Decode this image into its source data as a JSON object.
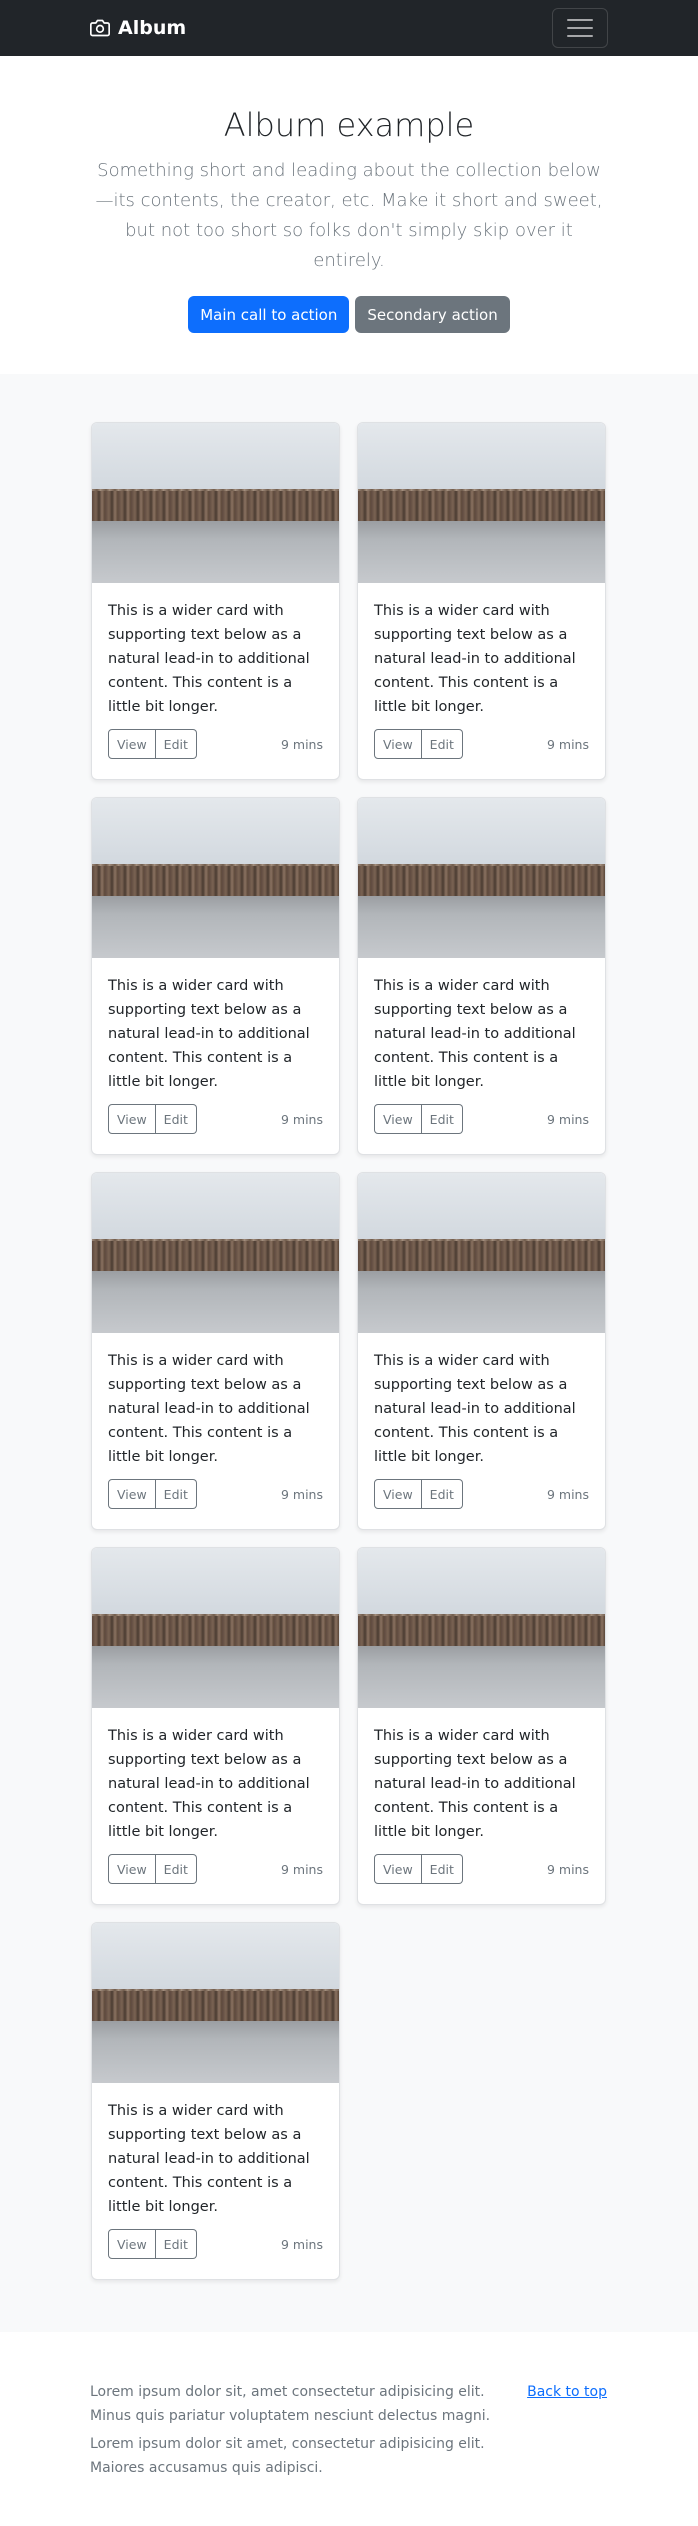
{
  "navbar": {
    "brand": "Album",
    "icons": {
      "brand": "camera-icon",
      "toggler": "hamburger-menu-icon"
    }
  },
  "hero": {
    "title": "Album example",
    "lead": "Something short and leading about the collection below—its contents, the creator, etc. Make it short and sweet, but not too short so folks don't simply skip over it entirely.",
    "primary_button": "Main call to action",
    "secondary_button": "Secondary action"
  },
  "cards": [
    {
      "text": "This is a wider card with supporting text below as a natural lead-in to additional content. This content is a little bit longer.",
      "view": "View",
      "edit": "Edit",
      "time": "9 mins"
    },
    {
      "text": "This is a wider card with supporting text below as a natural lead-in to additional content. This content is a little bit longer.",
      "view": "View",
      "edit": "Edit",
      "time": "9 mins"
    },
    {
      "text": "This is a wider card with supporting text below as a natural lead-in to additional content. This content is a little bit longer.",
      "view": "View",
      "edit": "Edit",
      "time": "9 mins"
    },
    {
      "text": "This is a wider card with supporting text below as a natural lead-in to additional content. This content is a little bit longer.",
      "view": "View",
      "edit": "Edit",
      "time": "9 mins"
    },
    {
      "text": "This is a wider card with supporting text below as a natural lead-in to additional content. This content is a little bit longer.",
      "view": "View",
      "edit": "Edit",
      "time": "9 mins"
    },
    {
      "text": "This is a wider card with supporting text below as a natural lead-in to additional content. This content is a little bit longer.",
      "view": "View",
      "edit": "Edit",
      "time": "9 mins"
    },
    {
      "text": "This is a wider card with supporting text below as a natural lead-in to additional content. This content is a little bit longer.",
      "view": "View",
      "edit": "Edit",
      "time": "9 mins"
    },
    {
      "text": "This is a wider card with supporting text below as a natural lead-in to additional content. This content is a little bit longer.",
      "view": "View",
      "edit": "Edit",
      "time": "9 mins"
    },
    {
      "text": "This is a wider card with supporting text below as a natural lead-in to additional content. This content is a little bit longer.",
      "view": "View",
      "edit": "Edit",
      "time": "9 mins"
    }
  ],
  "footer": {
    "back_to_top": "Back to top",
    "line1": "Lorem ipsum dolor sit, amet consectetur adipisicing elit. Minus quis pariatur voluptatem nesciunt delectus magni.",
    "line2": "Lorem ipsum dolor sit amet, consectetur adipisicing elit. Maiores accusamus quis adipisci."
  },
  "colors": {
    "navbar_bg": "#212529",
    "primary": "#0d6efd",
    "secondary": "#6c757d",
    "album_bg": "#f8f9fa"
  }
}
